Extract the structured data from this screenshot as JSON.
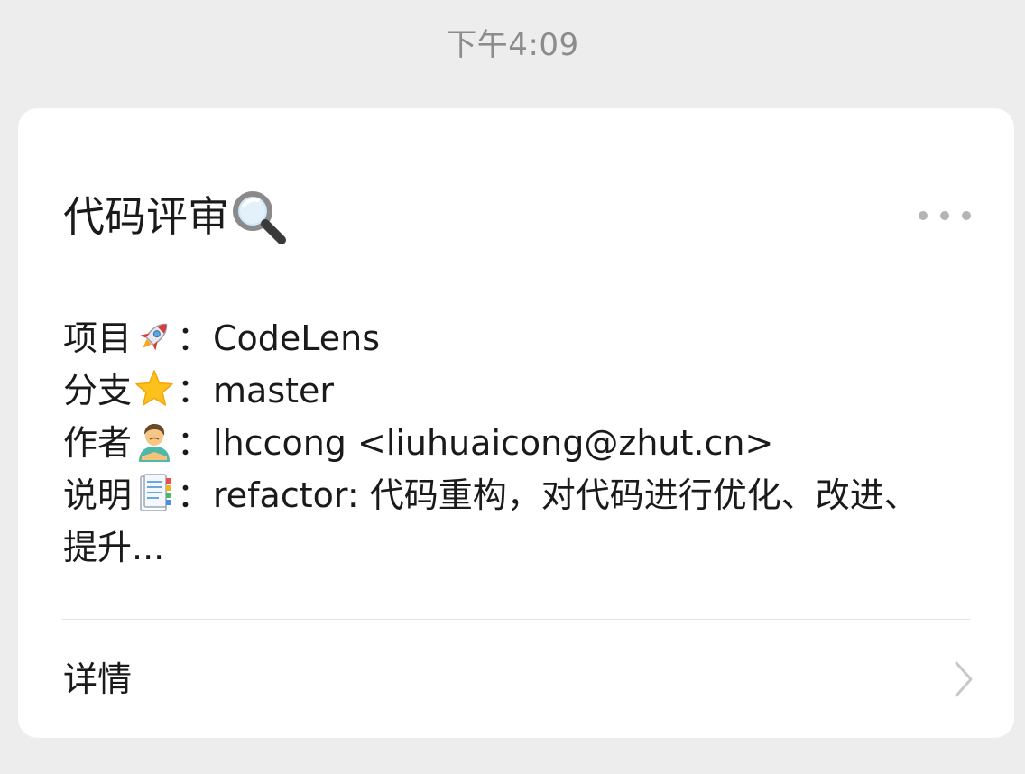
{
  "status_bar": {
    "timestamp": "下午4:09"
  },
  "card": {
    "title": "代码评审",
    "title_icon": "magnifying-glass-icon",
    "more_icon": "more-dots-icon",
    "rows": [
      {
        "label": "项目",
        "icon": "rocket-icon",
        "separator": "：",
        "value": "CodeLens"
      },
      {
        "label": "分支",
        "icon": "star-icon",
        "separator": "：",
        "value": "master"
      },
      {
        "label": "作者",
        "icon": "person-icon",
        "separator": "：",
        "value": "lhccong <liuhuaicong@zhut.cn>"
      },
      {
        "label": "说明",
        "icon": "notepad-icon",
        "separator": "：",
        "value": "refactor: 代码重构，对代码进行优化、改进、提升..."
      }
    ],
    "details_label": "详情",
    "details_icon": "chevron-right-icon"
  },
  "colors": {
    "page_background": "#ededed",
    "card_background": "#ffffff",
    "text": "#1a1a1a",
    "muted": "#8c8c8c"
  }
}
